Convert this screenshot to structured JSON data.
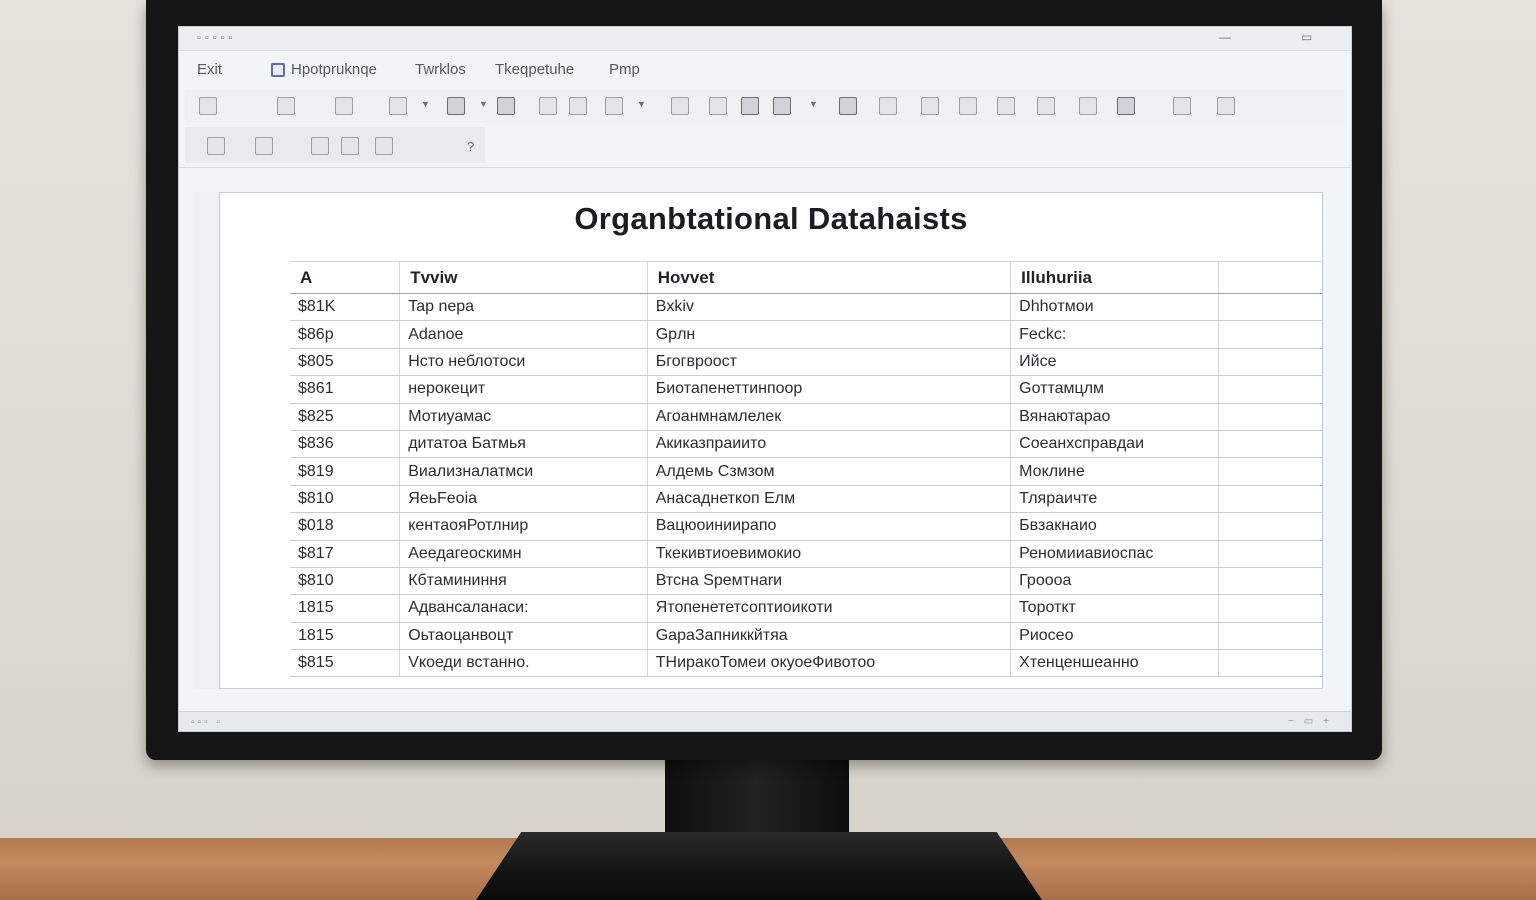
{
  "menubar": {
    "items": [
      "Exit",
      "Hpotpruknqe",
      "Twrklos",
      "Tkeqpetuhe",
      "Pmp"
    ]
  },
  "toolbar2": {
    "help_label": "?"
  },
  "sheet": {
    "title": "Organbtational Datahaists",
    "columns": [
      "A",
      "Tvviw",
      "Hovvet",
      "Illuhuriia",
      ""
    ],
    "rows": [
      [
        "$81K",
        "Tap nepa",
        "Bxkiv",
        "Dhhoтмои",
        ""
      ],
      [
        "$86p",
        "Adanoe",
        "Gpлн",
        "Feckc:",
        ""
      ],
      [
        "$805",
        "Нсто неблотоси",
        "Бгогвроост",
        "Ийсе",
        ""
      ],
      [
        "$861",
        "нерокецит",
        "Биотапенеттинпоор",
        "Gоттамцлм",
        ""
      ],
      [
        "$825",
        "Мотиуамас",
        "Агоанмнамлелек",
        "Вянаютарао",
        ""
      ],
      [
        "$836",
        "дитатоа Батмья",
        "Акиказпраиито",
        "Соеанхсправдаи",
        ""
      ],
      [
        "$819",
        "Виализналатмси",
        "Алдемь Сзмзом",
        "Моклине",
        ""
      ],
      [
        "$810",
        "ЯеьFeoia",
        "Анасаднеткоп Елм",
        "Тляраичте",
        ""
      ],
      [
        "$018",
        "кентаояРотлнир",
        "Вацюоиниирапо",
        "Бвзакнаио",
        ""
      ],
      [
        "$817",
        "Аеедагеоскимн",
        "Ткекивтиоевимокио",
        "Реномииавиоспас",
        ""
      ],
      [
        "$810",
        "Кбтамининня",
        "Втсна Speмтнаrи",
        "Гроооа",
        ""
      ],
      [
        "1815",
        "Адвансаланаси:",
        "Ятопенететсоптиоикоти",
        "Тороткт",
        ""
      ],
      [
        "1815",
        "Оьтаоцанвоцт",
        "GapaЗапниккйтяа",
        "Риосео",
        ""
      ],
      [
        "$815",
        "Vкоеди встанно.",
        "ТНиракоТомеи окуоеФивотоо",
        "Хтенценшеанно",
        ""
      ]
    ]
  }
}
